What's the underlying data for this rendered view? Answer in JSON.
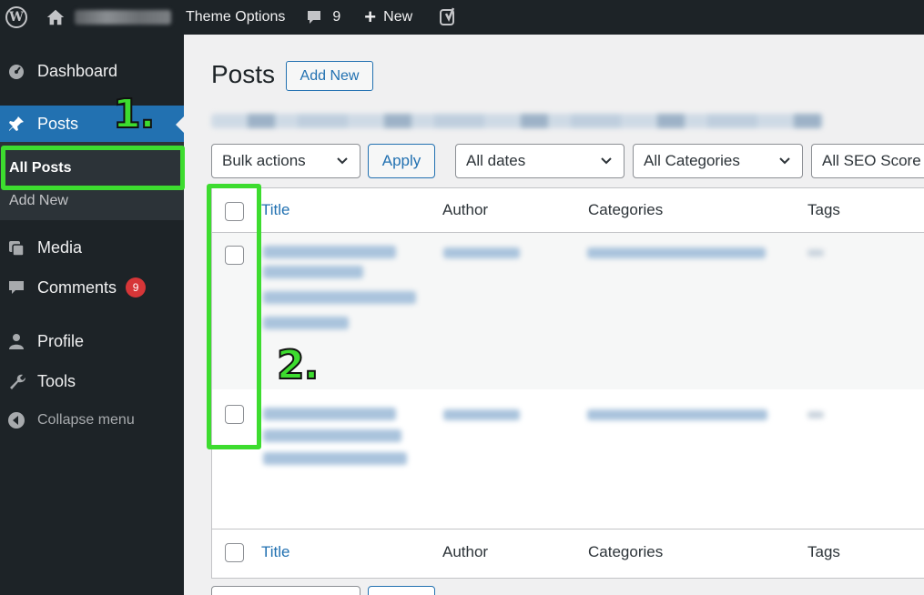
{
  "admin_bar": {
    "theme_options": "Theme Options",
    "comments_count": "9",
    "new_label": "New"
  },
  "sidebar": {
    "dashboard": "Dashboard",
    "posts": "Posts",
    "all_posts": "All Posts",
    "add_new": "Add New",
    "media": "Media",
    "comments": "Comments",
    "comments_badge": "9",
    "profile": "Profile",
    "tools": "Tools",
    "collapse": "Collapse menu"
  },
  "main": {
    "page_title": "Posts",
    "add_new_button": "Add New",
    "bulk_actions": "Bulk actions",
    "apply": "Apply",
    "all_dates": "All dates",
    "all_categories": "All Categories",
    "all_seo_scores": "All SEO Score"
  },
  "table": {
    "headers": [
      "Title",
      "Author",
      "Categories",
      "Tags"
    ],
    "footers": [
      "Title",
      "Author",
      "Categories",
      "Tags"
    ]
  },
  "annotations": {
    "step1": "1.",
    "step2": "2."
  },
  "colors": {
    "accent": "#2271b1",
    "admin_dark": "#1d2327",
    "highlight_green": "#3ddc2f",
    "badge_red": "#d63638"
  }
}
